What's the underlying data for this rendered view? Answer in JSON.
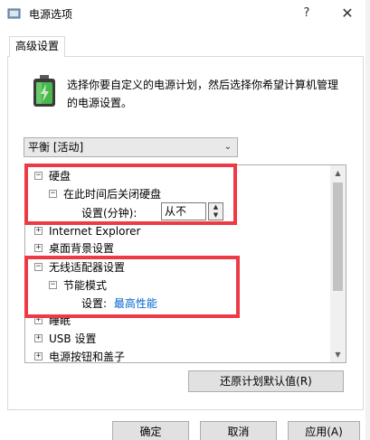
{
  "window": {
    "title": "电源选项",
    "help_label": "?",
    "close_label": "✕"
  },
  "tab": {
    "label": "高级设置"
  },
  "description": "选择你要自定义的电源计划，然后选择你希望计算机管理的电源设置。",
  "plan_select": {
    "value": "平衡 [活动]"
  },
  "tree": {
    "items": [
      {
        "label": "硬盘",
        "expander": "−"
      },
      {
        "label": "在此时间后关闭硬盘",
        "expander": "−"
      },
      {
        "label": "设置(分钟):",
        "value": "从不"
      },
      {
        "label": "Internet Explorer",
        "expander": "+"
      },
      {
        "label": "桌面背景设置",
        "expander": "+"
      },
      {
        "label": "无线适配器设置",
        "expander": "−"
      },
      {
        "label": "节能模式",
        "expander": "−"
      },
      {
        "label": "设置:",
        "value": "最高性能"
      },
      {
        "label": "睡眠",
        "expander": "+"
      },
      {
        "label": "USB 设置",
        "expander": "+"
      },
      {
        "label": "电源按钮和盖子",
        "expander": "+"
      }
    ]
  },
  "buttons": {
    "restore": "还原计划默认值(R)",
    "ok": "确定",
    "cancel": "取消",
    "apply": "应用(A)"
  },
  "colors": {
    "highlight": "#ee3a45",
    "link": "#0066cc"
  }
}
